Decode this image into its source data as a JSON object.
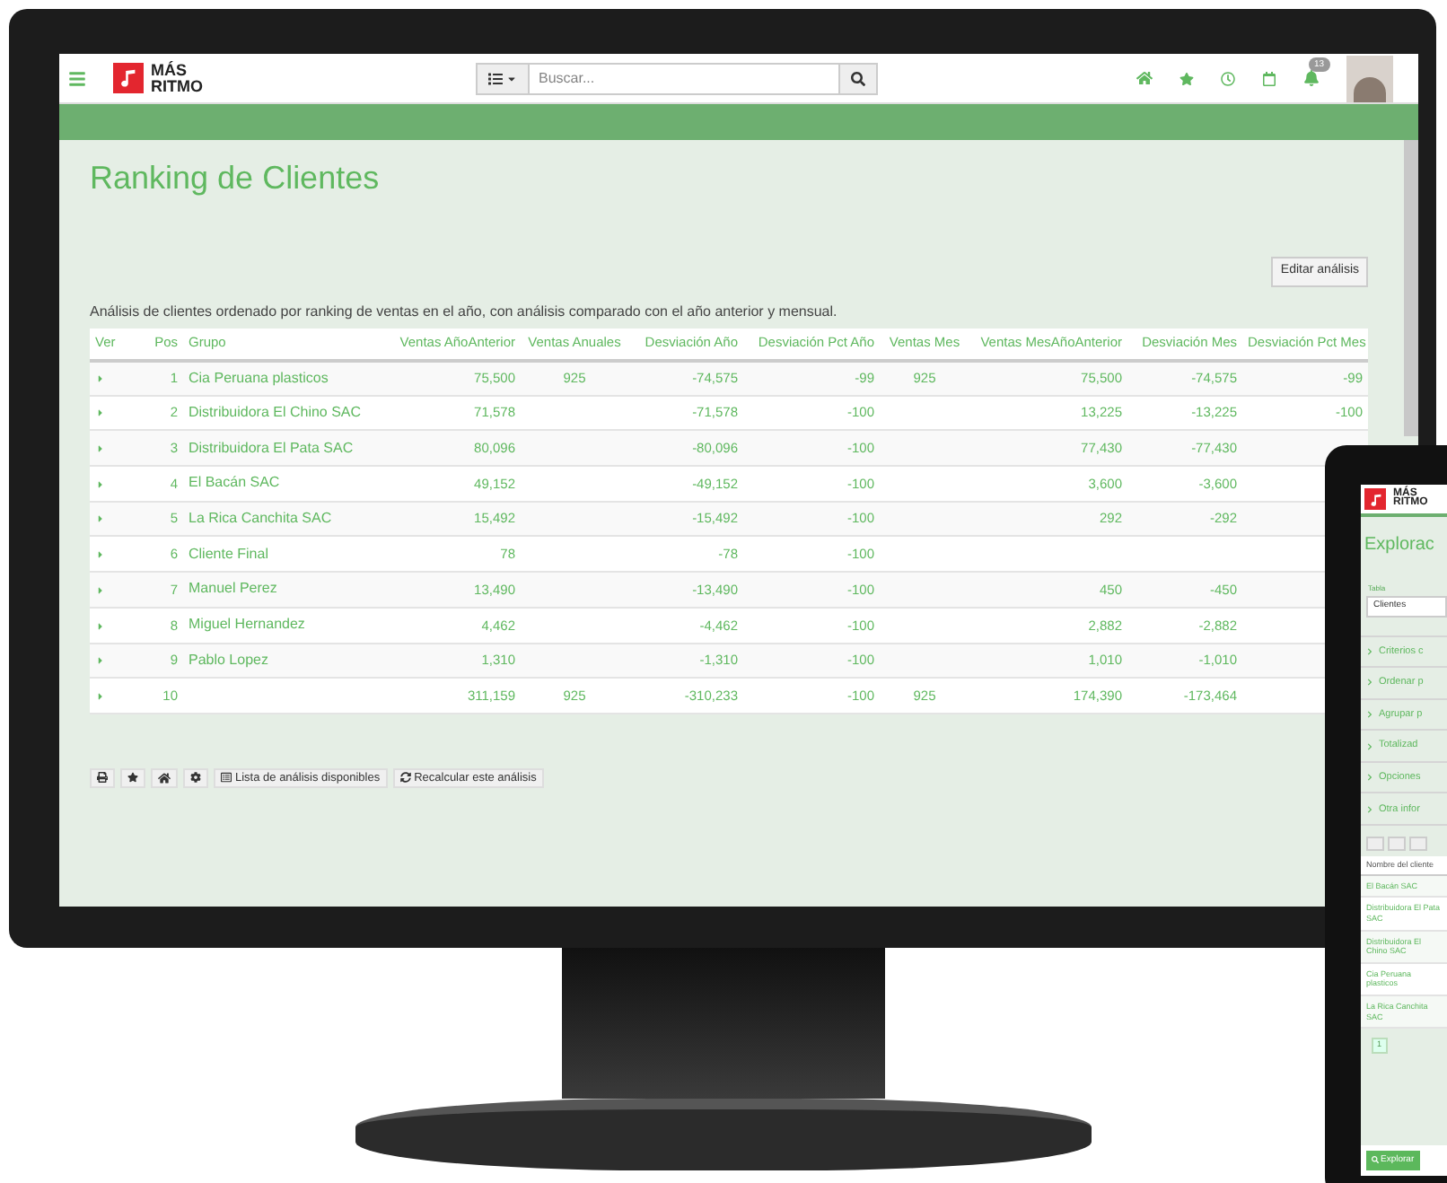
{
  "topbar": {
    "logo": [
      "MÁS",
      "RITMO"
    ],
    "search": {
      "placeholder": "Buscar..."
    },
    "notification_count": "13"
  },
  "page": {
    "title": "Ranking de Clientes",
    "edit_button": "Editar análisis",
    "description": "Análisis de clientes ordenado por ranking de ventas en el año, con análisis comparado con el año anterior y mensual.",
    "table": {
      "columns": [
        "Ver",
        "Pos",
        "Grupo",
        "Ventas AñoAnterior",
        "Ventas Anuales",
        "Desviación Año",
        "Desviación Pct Año",
        "Ventas Mes",
        "Ventas MesAñoAnterior",
        "Desviación Mes",
        "Desviación Pct Mes"
      ],
      "rows": [
        {
          "cells": [
            null,
            "1",
            "Cia Peruana plasticos",
            "75,500",
            "925",
            "-74,575",
            "-99",
            "925",
            "75,500",
            "-74,575",
            "-99"
          ]
        },
        {
          "cells": [
            null,
            "2",
            "Distribuidora El Chino SAC",
            "71,578",
            null,
            "-71,578",
            "-100",
            null,
            "13,225",
            "-13,225",
            "-100"
          ]
        },
        {
          "cells": [
            null,
            "3",
            "Distribuidora El Pata SAC",
            "80,096",
            null,
            "-80,096",
            "-100",
            null,
            "77,430",
            "-77,430",
            null
          ]
        },
        {
          "cells": [
            null,
            "4",
            "El Bacán SAC",
            "49,152",
            null,
            "-49,152",
            "-100",
            null,
            "3,600",
            "-3,600",
            null
          ]
        },
        {
          "cells": [
            null,
            "5",
            "La Rica Canchita SAC",
            "15,492",
            null,
            "-15,492",
            "-100",
            null,
            "292",
            "-292",
            null
          ]
        },
        {
          "cells": [
            null,
            "6",
            "Cliente Final",
            "78",
            null,
            "-78",
            "-100",
            null,
            null,
            null,
            null
          ]
        },
        {
          "cells": [
            null,
            "7",
            "Manuel Perez",
            "13,490",
            null,
            "-13,490",
            "-100",
            null,
            "450",
            "-450",
            null
          ]
        },
        {
          "cells": [
            null,
            "8",
            "Miguel Hernandez",
            "4,462",
            null,
            "-4,462",
            "-100",
            null,
            "2,882",
            "-2,882",
            null
          ]
        },
        {
          "cells": [
            null,
            "9",
            "Pablo Lopez",
            "1,310",
            null,
            "-1,310",
            "-100",
            null,
            "1,010",
            "-1,010",
            null
          ]
        },
        {
          "cells": [
            null,
            "10",
            null,
            "311,159",
            "925",
            "-310,233",
            "-100",
            "925",
            "174,390",
            "-173,464",
            null
          ]
        }
      ]
    },
    "toolbar_buttons": [
      "Lista de análisis disponibles",
      "Recalcular este análisis"
    ]
  },
  "tablet": {
    "logo": [
      "MÁS",
      "RITMO"
    ],
    "title": "Explorac",
    "table_label": "Tabla",
    "table_value": "Clientes",
    "sections": [
      "Criterios c",
      "Ordenar p",
      "Agrupar p",
      "Totalizad",
      "Opciones",
      "Otra infor"
    ],
    "list_header": "Nombre del cliente",
    "list_rows": [
      "El Bacán SAC",
      "Distribuidora El Pata SAC",
      "Distribuidora El Chino SAC",
      "Cia Peruana plasticos",
      "La Rica Canchita SAC"
    ],
    "page": "1",
    "explore_button": "Explorar"
  }
}
